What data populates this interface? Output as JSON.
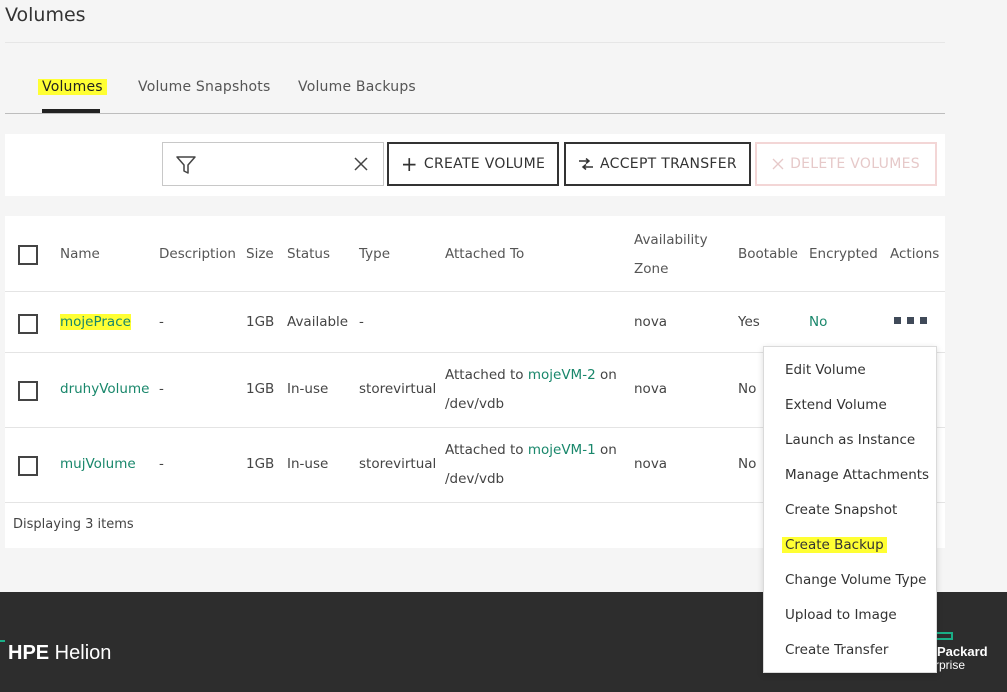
{
  "page": {
    "title": "Volumes"
  },
  "tabs": [
    {
      "label": "Volumes",
      "active": true
    },
    {
      "label": "Volume Snapshots",
      "active": false
    },
    {
      "label": "Volume Backups",
      "active": false
    }
  ],
  "toolbar": {
    "filter_placeholder": "",
    "create_volume": "CREATE VOLUME",
    "accept_transfer": "ACCEPT TRANSFER",
    "delete_volumes": "DELETE VOLUMES"
  },
  "table": {
    "headers": {
      "name": "Name",
      "description": "Description",
      "size": "Size",
      "status": "Status",
      "type": "Type",
      "attached_to": "Attached To",
      "availability_zone_1": "Availability",
      "availability_zone_2": "Zone",
      "bootable": "Bootable",
      "encrypted": "Encrypted",
      "actions": "Actions"
    },
    "rows": [
      {
        "name": "mojePrace",
        "description": "-",
        "size": "1GB",
        "status": "Available",
        "type": "-",
        "attached_prefix": "",
        "attached_vm": "",
        "attached_suffix": "",
        "attached_dev": "",
        "zone": "nova",
        "bootable": "Yes",
        "encrypted": "No"
      },
      {
        "name": "druhyVolume",
        "description": "-",
        "size": "1GB",
        "status": "In-use",
        "type": "storevirtual",
        "attached_prefix": "Attached to ",
        "attached_vm": "mojeVM-2",
        "attached_suffix": " on",
        "attached_dev": "/dev/vdb",
        "zone": "nova",
        "bootable": "No",
        "encrypted": ""
      },
      {
        "name": "mujVolume",
        "description": "-",
        "size": "1GB",
        "status": "In-use",
        "type": "storevirtual",
        "attached_prefix": "Attached to ",
        "attached_vm": "mojeVM-1",
        "attached_suffix": " on",
        "attached_dev": "/dev/vdb",
        "zone": "nova",
        "bootable": "No",
        "encrypted": ""
      }
    ],
    "footer": "Displaying 3 items"
  },
  "actions_menu": [
    "Edit Volume",
    "Extend Volume",
    "Launch as Instance",
    "Manage Attachments",
    "Create Snapshot",
    "Create Backup",
    "Change Volume Type",
    "Upload to Image",
    "Create Transfer"
  ],
  "branding": {
    "product_bold": "HPE",
    "product_name": " Helion",
    "company_line1": "Packard",
    "company_line2": "rprise"
  },
  "colors": {
    "link": "#19876b",
    "highlight": "#ffff33",
    "accent": "#1aae86"
  }
}
